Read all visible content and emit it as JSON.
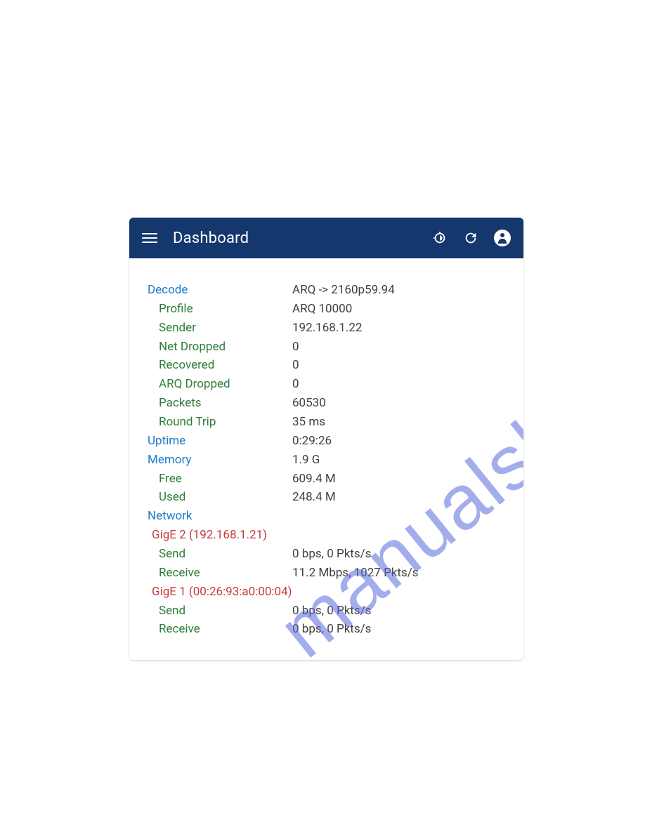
{
  "watermark": "manualshive.com",
  "header": {
    "title": "Dashboard"
  },
  "decode": {
    "label": "Decode",
    "value": "ARQ -> 2160p59.94",
    "profile_label": "Profile",
    "profile_value": "ARQ 10000",
    "sender_label": "Sender",
    "sender_value": "192.168.1.22",
    "net_dropped_label": "Net Dropped",
    "net_dropped_value": "0",
    "recovered_label": "Recovered",
    "recovered_value": "0",
    "arq_dropped_label": "ARQ Dropped",
    "arq_dropped_value": "0",
    "packets_label": "Packets",
    "packets_value": "60530",
    "round_trip_label": "Round Trip",
    "round_trip_value": "35 ms"
  },
  "uptime": {
    "label": "Uptime",
    "value": "0:29:26"
  },
  "memory": {
    "label": "Memory",
    "value": "1.9 G",
    "free_label": "Free",
    "free_value": "609.4 M",
    "used_label": "Used",
    "used_value": "248.4 M"
  },
  "network": {
    "label": "Network",
    "if1": {
      "title": "GigE 2 (192.168.1.21)",
      "send_label": "Send",
      "send_value": "0 bps, 0 Pkts/s",
      "receive_label": "Receive",
      "receive_value": "11.2 Mbps, 1027 Pkts/s"
    },
    "if2": {
      "title": "GigE 1 (00:26:93:a0:00:04)",
      "send_label": "Send",
      "send_value": "0 bps, 0 Pkts/s",
      "receive_label": "Receive",
      "receive_value": "0 bps, 0 Pkts/s"
    }
  }
}
